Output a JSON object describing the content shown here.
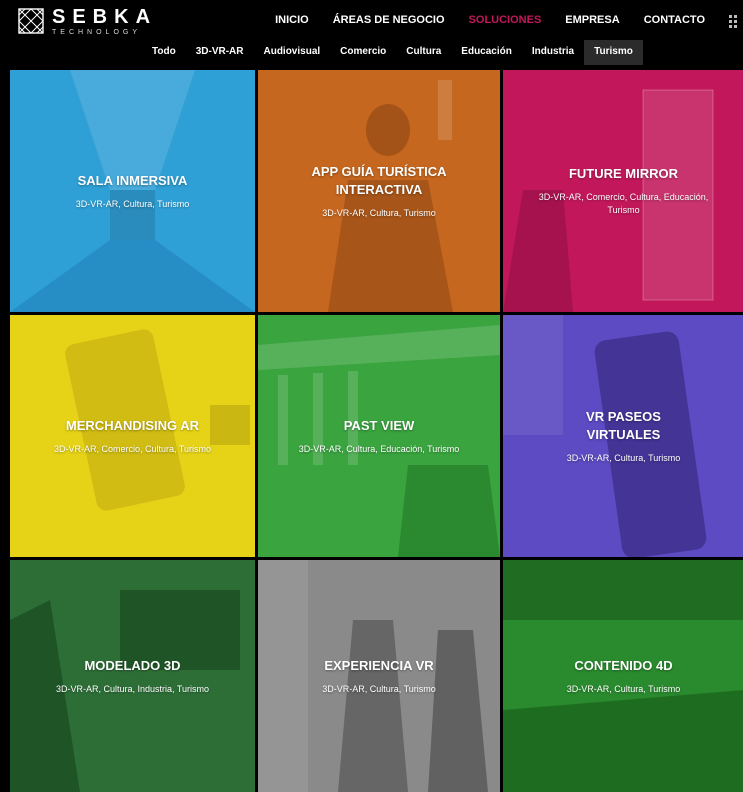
{
  "logo": {
    "brand": "SEBKA",
    "sub": "TECHNOLOGY"
  },
  "nav": [
    {
      "label": "INICIO",
      "active": false
    },
    {
      "label": "ÁREAS DE NEGOCIO",
      "active": false
    },
    {
      "label": "SOLUCIONES",
      "active": true
    },
    {
      "label": "EMPRESA",
      "active": false
    },
    {
      "label": "CONTACTO",
      "active": false
    }
  ],
  "filters": [
    "Todo",
    "3D-VR-AR",
    "Audiovisual",
    "Comercio",
    "Cultura",
    "Educación",
    "Industria",
    "Turismo"
  ],
  "active_filter": "Turismo",
  "tiles": [
    {
      "title": "SALA INMERSIVA",
      "tags": "3D-VR-AR, Cultura, Turismo",
      "color": "#2fa0d6"
    },
    {
      "title": "APP GUÍA TURÍSTICA INTERACTIVA",
      "tags": "3D-VR-AR, Cultura, Turismo",
      "color": "#c6671f"
    },
    {
      "title": "FUTURE MIRROR",
      "tags": "3D-VR-AR, Comercio, Cultura, Educación, Turismo",
      "color": "#c2185b"
    },
    {
      "title": "MERCHANDISING AR",
      "tags": "3D-VR-AR, Comercio, Cultura, Turismo",
      "color": "#e6d317"
    },
    {
      "title": "PAST VIEW",
      "tags": "3D-VR-AR, Cultura, Educación, Turismo",
      "color": "#3aa43f"
    },
    {
      "title": "VR PASEOS VIRTUALES",
      "tags": "3D-VR-AR, Cultura, Turismo",
      "color": "#5c4bc2"
    },
    {
      "title": "MODELADO 3D",
      "tags": "3D-VR-AR, Cultura, Industria, Turismo",
      "color": "#2d6e37"
    },
    {
      "title": "EXPERIENCIA VR",
      "tags": "3D-VR-AR, Cultura, Turismo",
      "color": "#8a8a8a"
    },
    {
      "title": "CONTENIDO 4D",
      "tags": "3D-VR-AR, Cultura, Turismo",
      "color": "#2a8a2e"
    }
  ]
}
